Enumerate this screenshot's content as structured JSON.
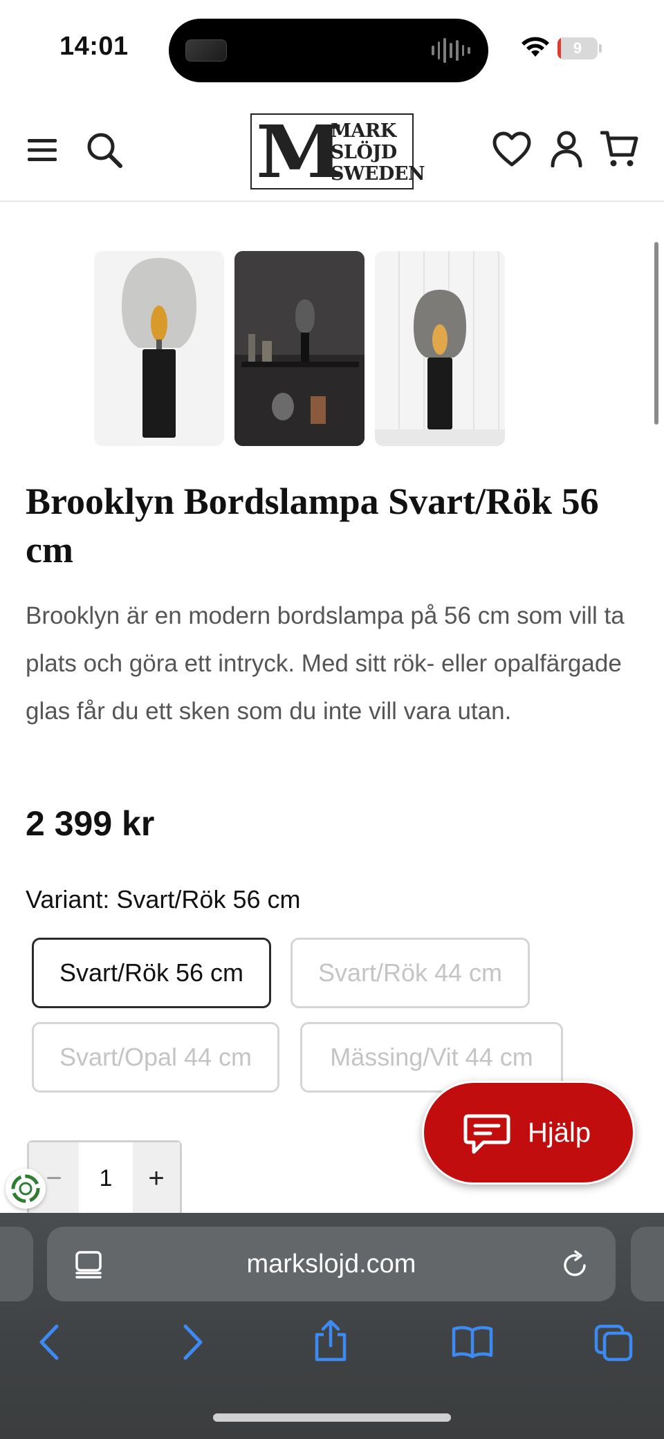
{
  "status_bar": {
    "time": "14:01",
    "battery_level": "9",
    "battery_fraction": 0.09,
    "battery_color": "#e03a2f"
  },
  "header": {
    "logo_letter": "M",
    "logo_lines": [
      "MARK",
      "SLÖJD",
      "SWEDEN"
    ],
    "icons": [
      "menu-icon",
      "search-icon",
      "heart-icon",
      "account-icon",
      "cart-icon"
    ]
  },
  "gallery": {
    "thumbnails": [
      "product-image-1",
      "product-image-2",
      "product-image-3"
    ]
  },
  "product": {
    "title": "Brooklyn Bordslampa Svart/Rök 56 cm",
    "description": "Brooklyn är en modern bordslampa på 56 cm som vill ta plats och göra ett intryck. Med sitt rök- eller opalfärgade glas får du ett sken som du inte vill vara utan.",
    "price": "2 399 kr",
    "variant_label": "Variant: Svart/Rök 56 cm",
    "variants": [
      {
        "label": "Svart/Rök 56 cm",
        "selected": true
      },
      {
        "label": "Svart/Rök 44 cm",
        "selected": false
      },
      {
        "label": "Svart/Opal 44 cm",
        "selected": false
      },
      {
        "label": "Mässing/Vit 44 cm",
        "selected": false
      }
    ],
    "quantity": {
      "minus": "−",
      "value": "1",
      "plus": "+"
    }
  },
  "help_button": {
    "label": "Hjälp",
    "color": "#c10d0d"
  },
  "browser": {
    "url": "markslojd.com",
    "accent": "#3d8bf2",
    "toolbar_icons": [
      "back-icon",
      "forward-icon",
      "share-icon",
      "bookmarks-icon",
      "tabs-icon"
    ]
  }
}
